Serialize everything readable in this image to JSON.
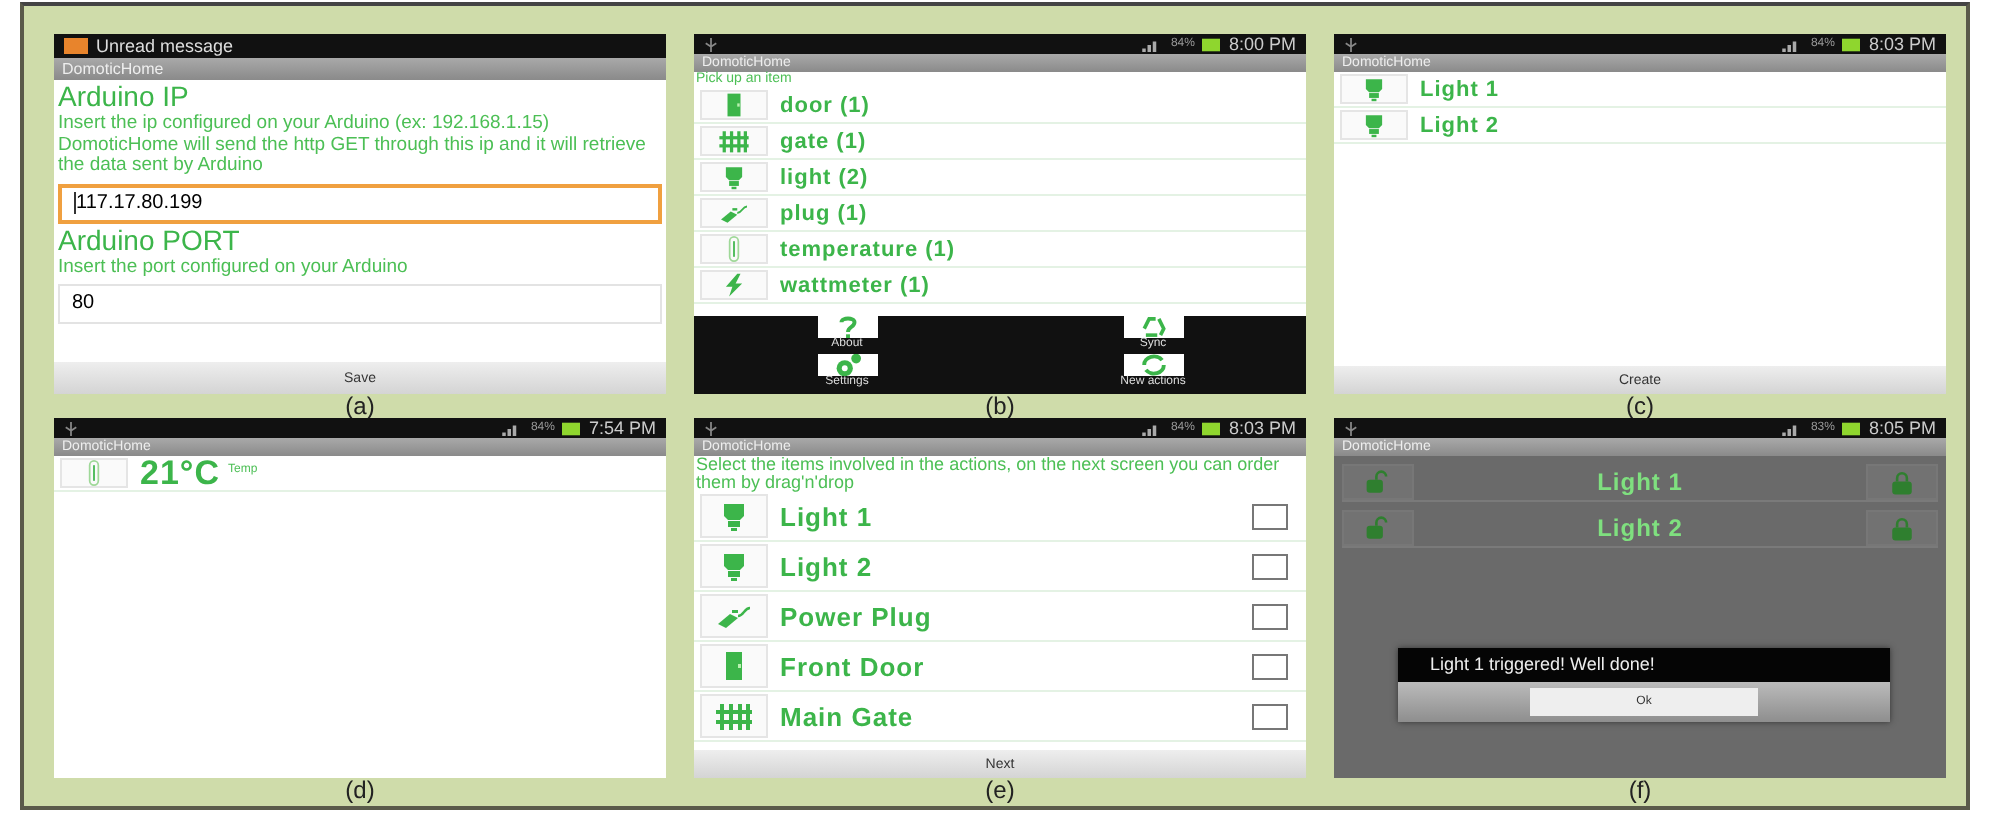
{
  "panels": [
    {
      "kind": "form",
      "caption": "(a)",
      "status_bar": {
        "notification": "Unread message"
      },
      "app_title": "DomoticHome",
      "sections": [
        {
          "heading": "Arduino IP",
          "description": "Insert the ip configured on your Arduino (ex: 192.168.1.15) DomoticHome will send the http GET through this ip and it will retrieve the data sent by Arduino",
          "value": "117.17.80.199",
          "focused": true
        },
        {
          "heading": "Arduino PORT",
          "description": "Insert the port configured on your Arduino",
          "value": "80",
          "focused": false
        }
      ],
      "button": "Save"
    },
    {
      "kind": "list",
      "caption": "(b)",
      "status_bar": {
        "battery": "84%",
        "time": "8:00 PM"
      },
      "app_title": "DomoticHome",
      "hint": "Pick up an item",
      "items": [
        {
          "kind": "door",
          "label": "door (1)"
        },
        {
          "kind": "gate",
          "label": "gate (1)"
        },
        {
          "kind": "light",
          "label": "light (2)"
        },
        {
          "kind": "plug",
          "label": "plug (1)"
        },
        {
          "kind": "temperature",
          "label": "temperature (1)"
        },
        {
          "kind": "wattmeter",
          "label": "wattmeter (1)"
        }
      ],
      "toolbar": [
        {
          "kind": "question",
          "label": "About"
        },
        {
          "kind": "recycle",
          "label": "Sync"
        },
        {
          "kind": "gears",
          "label": "Settings"
        },
        {
          "kind": "refresh",
          "label": "New actions"
        }
      ]
    },
    {
      "kind": "list",
      "caption": "(c)",
      "status_bar": {
        "battery": "84%",
        "time": "8:03 PM"
      },
      "app_title": "DomoticHome",
      "items": [
        {
          "kind": "light",
          "label": "Light 1"
        },
        {
          "kind": "light",
          "label": "Light 2"
        }
      ],
      "button": "Create"
    },
    {
      "kind": "list",
      "caption": "(d)",
      "status_bar": {
        "battery": "84%",
        "time": "7:54 PM"
      },
      "app_title": "DomoticHome",
      "items": [
        {
          "kind": "temperature",
          "label": "21°C",
          "note": "Temp"
        }
      ]
    },
    {
      "kind": "select",
      "caption": "(e)",
      "status_bar": {
        "battery": "84%",
        "time": "8:03 PM"
      },
      "app_title": "DomoticHome",
      "hint": "Select the items involved in the actions, on the next screen you can order them by drag'n'drop",
      "items": [
        {
          "kind": "light",
          "label": "Light 1",
          "checked": false
        },
        {
          "kind": "light",
          "label": "Light 2",
          "checked": false
        },
        {
          "kind": "plug",
          "label": "Power Plug",
          "checked": false
        },
        {
          "kind": "door",
          "label": "Front Door",
          "checked": false
        },
        {
          "kind": "gate",
          "label": "Main Gate",
          "checked": false
        }
      ],
      "button": "Next"
    },
    {
      "kind": "control",
      "caption": "(f)",
      "status_bar": {
        "battery": "83%",
        "time": "8:05 PM"
      },
      "app_title": "DomoticHome",
      "items": [
        {
          "label": "Light 1"
        },
        {
          "label": "Light 2"
        }
      ],
      "dialog": {
        "message": "Light 1 triggered! Well done!",
        "button": "Ok"
      }
    }
  ]
}
